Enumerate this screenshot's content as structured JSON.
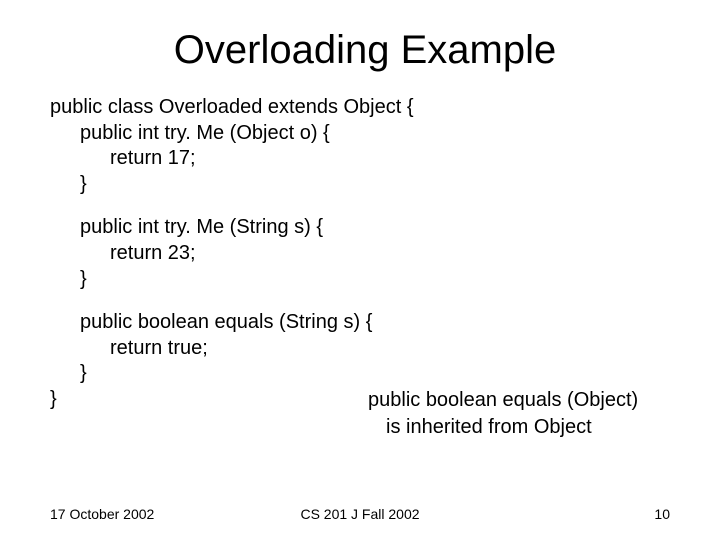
{
  "title": "Overloading Example",
  "code": {
    "block1": {
      "l1": "public class Overloaded extends Object {",
      "l2": "public int try. Me (Object o) {",
      "l3": "return 17;",
      "l4": "}"
    },
    "block2": {
      "l1": "public int try. Me (String s) {",
      "l2": "return 23;",
      "l3": "}"
    },
    "block3": {
      "l1": "public boolean equals (String s) {",
      "l2": "return true;",
      "l3": "}",
      "l4": "}"
    }
  },
  "note": {
    "l1": "public boolean equals (Object)",
    "l2": "is inherited from Object"
  },
  "footer": {
    "date": "17 October 2002",
    "course": "CS 201 J Fall 2002",
    "page": "10"
  }
}
